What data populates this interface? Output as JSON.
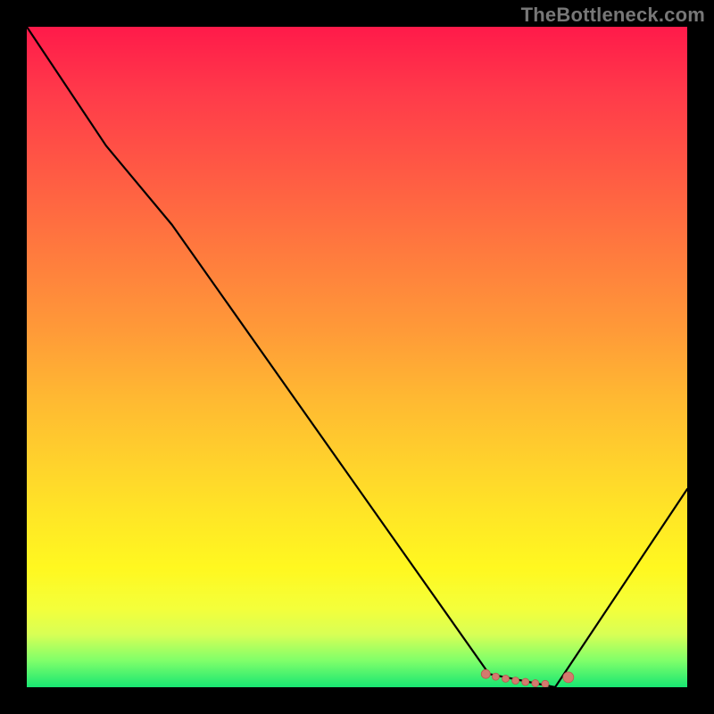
{
  "watermark": "TheBottleneck.com",
  "colors": {
    "background": "#000000",
    "curve": "#000000",
    "marker_fill": "#d47a6e",
    "marker_stroke": "#b85a4f"
  },
  "chart_data": {
    "type": "line",
    "title": "",
    "xlabel": "",
    "ylabel": "",
    "xlim": [
      0,
      100
    ],
    "ylim": [
      0,
      100
    ],
    "grid": false,
    "series": [
      {
        "name": "bottleneck-curve",
        "x": [
          0,
          12,
          22,
          70,
          80,
          100
        ],
        "values": [
          100,
          82,
          70,
          2,
          0,
          30
        ]
      }
    ],
    "markers": {
      "name": "optimal-points",
      "points": [
        {
          "x": 69.5,
          "y": 2.0,
          "r": 5
        },
        {
          "x": 71.0,
          "y": 1.6,
          "r": 4
        },
        {
          "x": 72.5,
          "y": 1.3,
          "r": 4
        },
        {
          "x": 74.0,
          "y": 1.0,
          "r": 4
        },
        {
          "x": 75.5,
          "y": 0.8,
          "r": 4
        },
        {
          "x": 77.0,
          "y": 0.6,
          "r": 4
        },
        {
          "x": 78.5,
          "y": 0.5,
          "r": 4
        },
        {
          "x": 82.0,
          "y": 1.5,
          "r": 6
        }
      ]
    }
  }
}
